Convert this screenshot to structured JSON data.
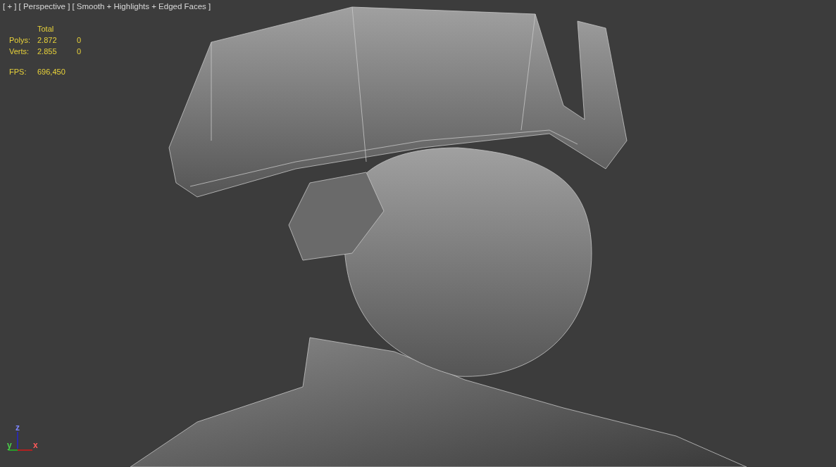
{
  "viewport": {
    "menus": [
      {
        "label": "[ + ]"
      },
      {
        "label": "[ Perspective ]"
      },
      {
        "label": "[ Smooth + Highlights + Edged Faces ]"
      }
    ],
    "stats": {
      "header": "Total",
      "rows": [
        {
          "label": "Polys:",
          "total": "2.872",
          "column_3": "0"
        },
        {
          "label": "Verts:",
          "total": "2.855",
          "column_3": "0"
        }
      ],
      "fps": {
        "label": "FPS:",
        "value": "696,450"
      }
    },
    "axes": [
      {
        "label": "z",
        "kind": "z"
      },
      {
        "label": "y",
        "kind": "y"
      },
      {
        "label": "x",
        "kind": "x"
      }
    ]
  }
}
